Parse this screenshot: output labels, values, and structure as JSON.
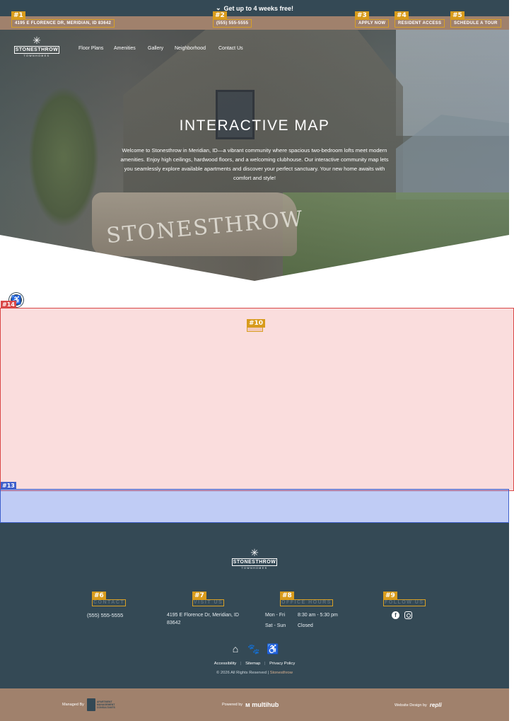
{
  "promo": {
    "text": "Get up to 4 weeks free!",
    "icon": "chevron-down-icon"
  },
  "utility_bar": {
    "address": "4195 E FLORENCE DR, MERIDIAN, ID 83642",
    "phone": "(555) 555-5555",
    "apply": "APPLY NOW",
    "resident": "RESIDENT ACCESS",
    "tour": "SCHEDULE A TOUR"
  },
  "markers": {
    "m1": "#1",
    "m2": "#2",
    "m3": "#3",
    "m4": "#4",
    "m5": "#5",
    "m6": "#6",
    "m7": "#7",
    "m8": "#8",
    "m9": "#9",
    "m10": "#10",
    "m13": "#13",
    "m14": "#14"
  },
  "logo": {
    "name": "STONESTHROW",
    "sub": "TOWNHOMES"
  },
  "nav": {
    "items": [
      "Floor Plans",
      "Amenities",
      "Gallery",
      "Neighborhood",
      "Contact Us"
    ]
  },
  "hero": {
    "image_text": "STONESTHROW",
    "title": "INTERACTIVE MAP",
    "description": "Welcome to Stonesthrow in Meridian, ID—a vibrant community where spacious two-bedroom lofts meet modern amenities. Enjoy high ceilings, hardwood floors, and a welcoming clubhouse. Our interactive community map lets you seamlessly explore available apartments and discover your perfect sanctuary. Your new home awaits with comfort and style!"
  },
  "footer": {
    "contact": {
      "heading": "CONTACT",
      "phone": "(555) 555-5555"
    },
    "visit": {
      "heading": "VISIT US",
      "address": "4195 E Florence Dr, Meridian, ID 83642"
    },
    "hours": {
      "heading": "OFFICE HOURS",
      "rows": [
        {
          "days": "Mon - Fri",
          "time": "8:30 am - 5:30 pm"
        },
        {
          "days": "Sat - Sun",
          "time": "Closed"
        }
      ]
    },
    "follow": {
      "heading": "FOLLOW US",
      "icons": [
        "facebook-icon",
        "instagram-icon"
      ]
    },
    "amenity_icons": [
      "equal-housing-icon",
      "pet-friendly-icon",
      "wheelchair-accessible-icon"
    ],
    "links": [
      "Accessibility",
      "Sitemap",
      "Privacy Policy"
    ],
    "copyright_prefix": "© 2026 All Rights Reserved | ",
    "copyright_brand": "Stonesthrow"
  },
  "bottom_bar": {
    "managed_by": "Managed By",
    "amc_text": "APARTMENT MANAGEMENT CONSULTANTS",
    "powered_by": "Powered by",
    "multihub": "multihub",
    "design_by": "Website Design by",
    "repli": "repli"
  },
  "colors": {
    "primary": "#344955",
    "accent_tan": "#a0816c",
    "marker_gold": "#d89b1c",
    "map_overlay": "#e85454",
    "blue_overlay": "#5a78e6"
  }
}
